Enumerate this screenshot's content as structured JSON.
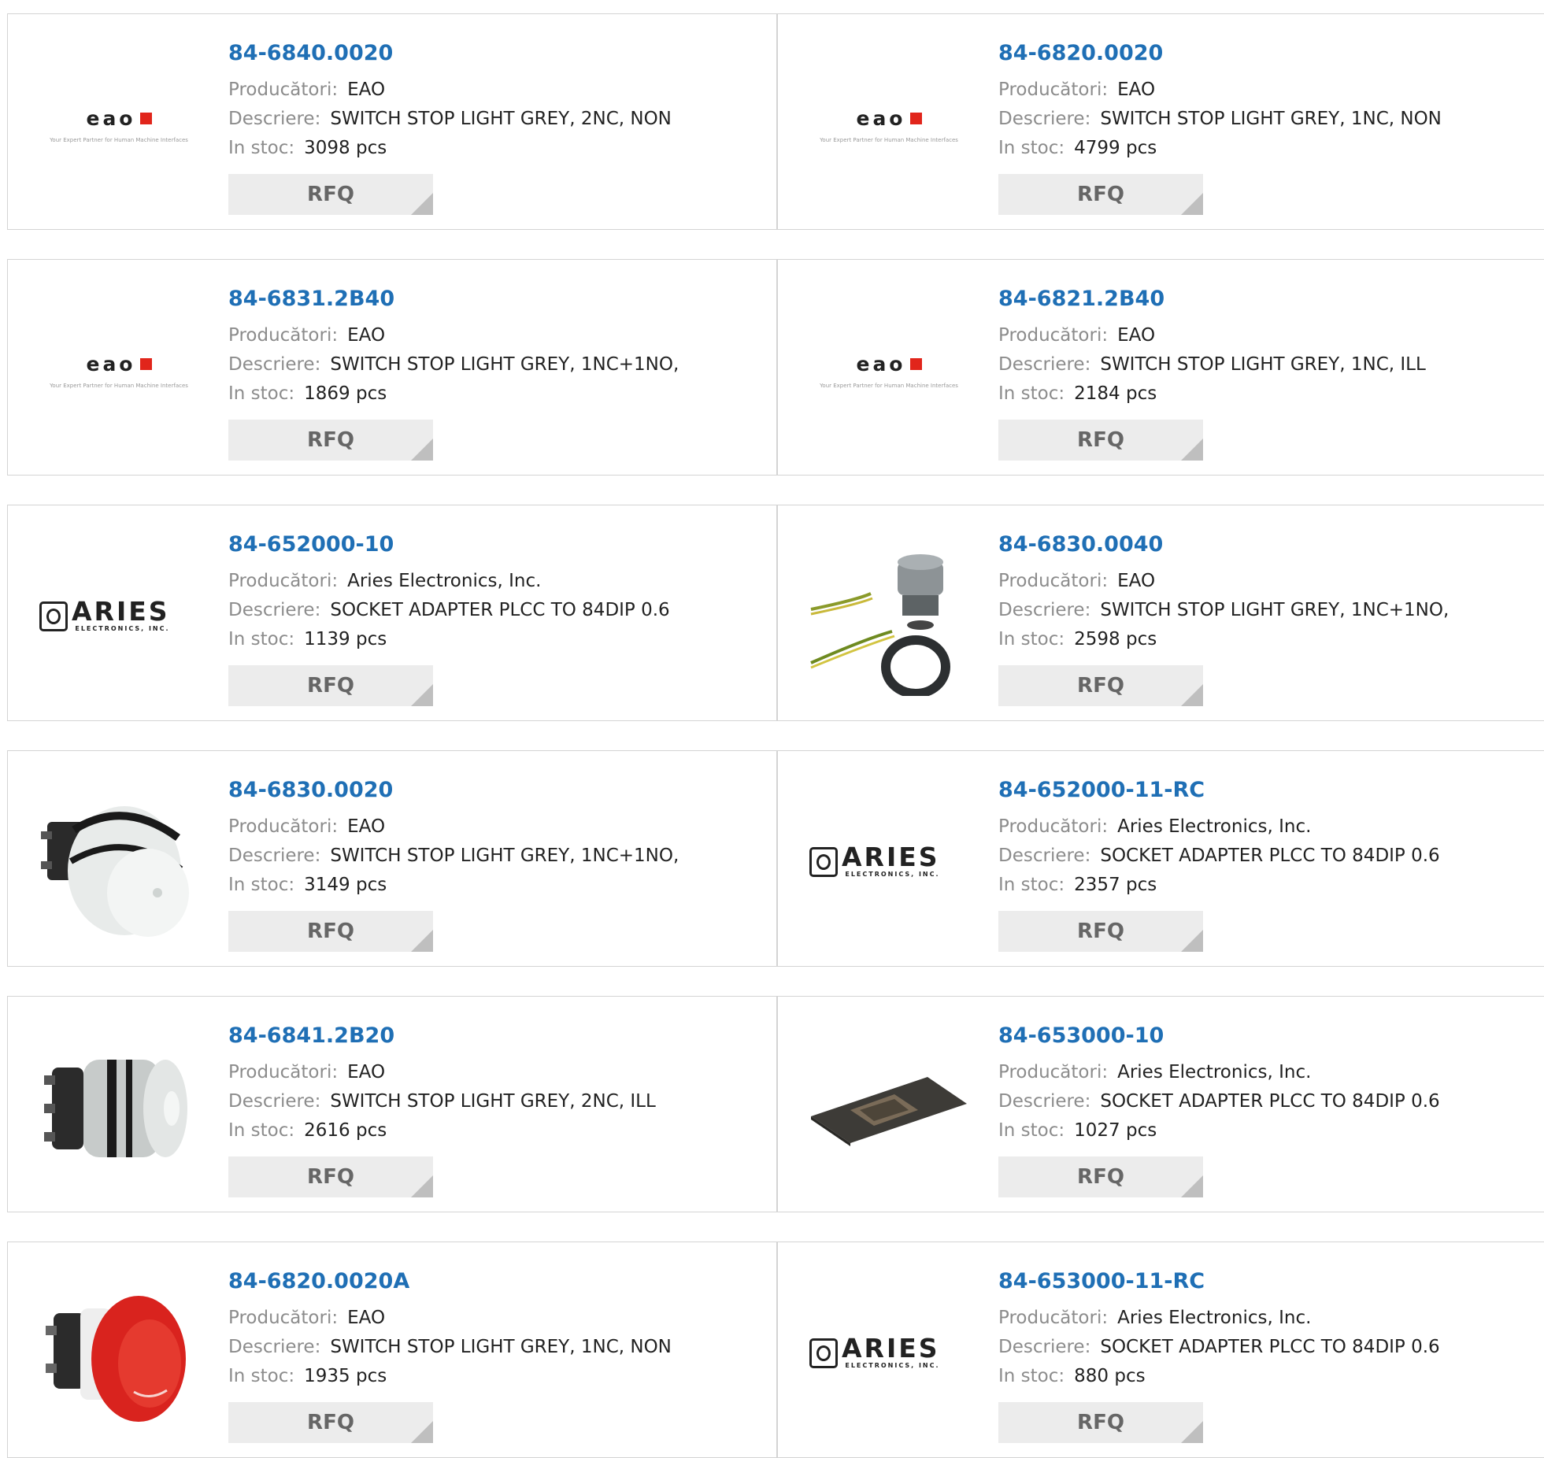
{
  "labels": {
    "manufacturer": "Producători:",
    "description": "Descriere:",
    "stock": "In stoc:",
    "rfq": "RFQ"
  },
  "eao_logo": {
    "word": "eao",
    "tagline": "Your Expert Partner for Human Machine Interfaces"
  },
  "aries_logo": {
    "word": "ARIES",
    "sub": "ELECTRONICS, INC."
  },
  "colors": {
    "accent": "#1f6fb5",
    "eao_red": "#e1251b"
  },
  "products": [
    {
      "part": "84-6840.0020",
      "manufacturer": "EAO",
      "description": "SWITCH STOP LIGHT GREY, 2NC, NON",
      "stock": "3098 pcs",
      "image": "eao-logo"
    },
    {
      "part": "84-6820.0020",
      "manufacturer": "EAO",
      "description": "SWITCH STOP LIGHT GREY, 1NC, NON",
      "stock": "4799 pcs",
      "image": "eao-logo"
    },
    {
      "part": "84-6831.2B40",
      "manufacturer": "EAO",
      "description": "SWITCH STOP LIGHT GREY, 1NC+1NO,",
      "stock": "1869 pcs",
      "image": "eao-logo"
    },
    {
      "part": "84-6821.2B40",
      "manufacturer": "EAO",
      "description": "SWITCH STOP LIGHT GREY, 1NC, ILL",
      "stock": "2184 pcs",
      "image": "eao-logo"
    },
    {
      "part": "84-652000-10",
      "manufacturer": "Aries Electronics, Inc.",
      "description": "SOCKET ADAPTER PLCC TO 84DIP 0.6",
      "stock": "1139 pcs",
      "image": "aries-logo"
    },
    {
      "part": "84-6830.0040",
      "manufacturer": "EAO",
      "description": "SWITCH STOP LIGHT GREY, 1NC+1NO,",
      "stock": "2598 pcs",
      "image": "switch-wired"
    },
    {
      "part": "84-6830.0020",
      "manufacturer": "EAO",
      "description": "SWITCH STOP LIGHT GREY, 1NC+1NO,",
      "stock": "3149 pcs",
      "image": "switch-grey"
    },
    {
      "part": "84-652000-11-RC",
      "manufacturer": "Aries Electronics, Inc.",
      "description": "SOCKET ADAPTER PLCC TO 84DIP 0.6",
      "stock": "2357 pcs",
      "image": "aries-logo"
    },
    {
      "part": "84-6841.2B20",
      "manufacturer": "EAO",
      "description": "SWITCH STOP LIGHT GREY, 2NC, ILL",
      "stock": "2616 pcs",
      "image": "switch-grey-side"
    },
    {
      "part": "84-653000-10",
      "manufacturer": "Aries Electronics, Inc.",
      "description": "SOCKET ADAPTER PLCC TO 84DIP 0.6",
      "stock": "1027 pcs",
      "image": "socket-board"
    },
    {
      "part": "84-6820.0020A",
      "manufacturer": "EAO",
      "description": "SWITCH STOP LIGHT GREY, 1NC, NON",
      "stock": "1935 pcs",
      "image": "switch-red"
    },
    {
      "part": "84-653000-11-RC",
      "manufacturer": "Aries Electronics, Inc.",
      "description": "SOCKET ADAPTER PLCC TO 84DIP 0.6",
      "stock": "880 pcs",
      "image": "aries-logo"
    }
  ]
}
